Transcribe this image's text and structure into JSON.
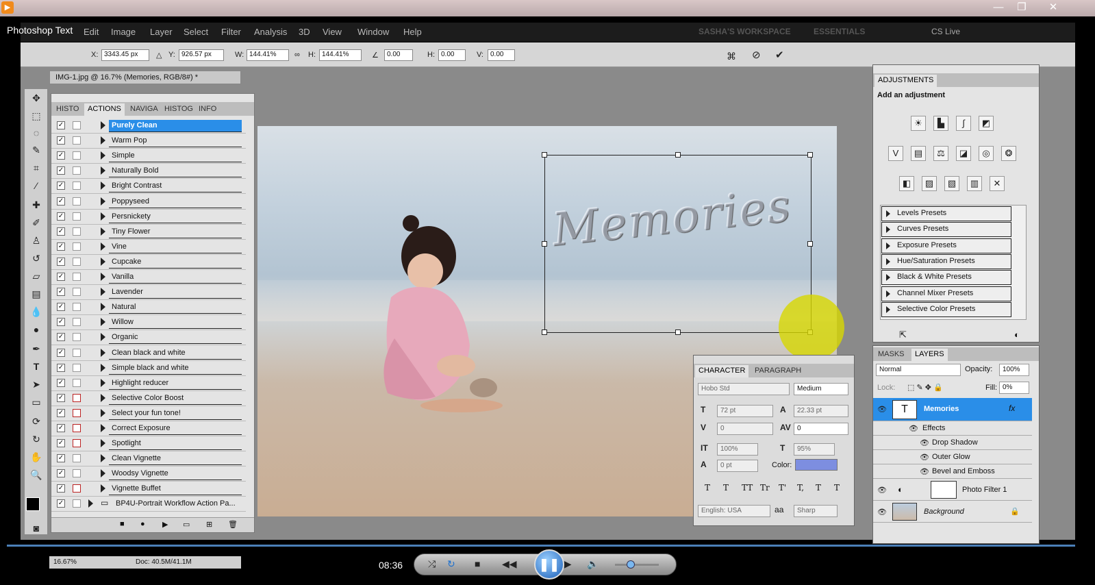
{
  "window": {
    "title": "Photoshop Text",
    "controls": [
      "—",
      "❐",
      "✕"
    ]
  },
  "menu": [
    "Edit",
    "Image",
    "Layer",
    "Select",
    "Filter",
    "Analysis",
    "3D",
    "View",
    "Window",
    "Help"
  ],
  "workspace": [
    "SASHA'S WORKSPACE",
    "ESSENTIALS",
    "CS Live"
  ],
  "options": {
    "x_label": "X:",
    "x_value": "3343.45 px",
    "y_label": "Y:",
    "y_value": "926.57 px",
    "w_label": "W:",
    "w_value": "144.41%",
    "h_label": "H:",
    "h_value": "144.41%",
    "angle_value": "0.00",
    "hskew_label": "H:",
    "hskew_value": "0.00",
    "vskew_label": "V:",
    "vskew_value": "0.00"
  },
  "document": {
    "tab_title": "IMG-1.jpg @ 16.7% (Memories, RGB/8#) *",
    "zoom": "16.67%",
    "doc_size": "Doc: 40.5M/41.1M"
  },
  "actions_panel": {
    "tabs": [
      "HISTO",
      "ACTIONS",
      "NAVIGA",
      "HISTOG",
      "INFO"
    ],
    "items": [
      {
        "name": "Purely Clean",
        "dialog": false,
        "selected": true
      },
      {
        "name": "Warm Pop",
        "dialog": false
      },
      {
        "name": "Simple",
        "dialog": false
      },
      {
        "name": "Naturally Bold",
        "dialog": false
      },
      {
        "name": "Bright Contrast",
        "dialog": false
      },
      {
        "name": "Poppyseed",
        "dialog": false
      },
      {
        "name": "Persnickety",
        "dialog": false
      },
      {
        "name": "Tiny Flower",
        "dialog": false
      },
      {
        "name": "Vine",
        "dialog": false
      },
      {
        "name": "Cupcake",
        "dialog": false
      },
      {
        "name": "Vanilla",
        "dialog": false
      },
      {
        "name": "Lavender",
        "dialog": false
      },
      {
        "name": "Natural",
        "dialog": false
      },
      {
        "name": "Willow",
        "dialog": false
      },
      {
        "name": "Organic",
        "dialog": false
      },
      {
        "name": "Clean black and white",
        "dialog": false
      },
      {
        "name": "Simple black and white",
        "dialog": false
      },
      {
        "name": "Highlight reducer",
        "dialog": false
      },
      {
        "name": "Selective Color Boost",
        "dialog": true
      },
      {
        "name": "Select your fun tone!",
        "dialog": true
      },
      {
        "name": "Correct Exposure",
        "dialog": true
      },
      {
        "name": "Spotlight",
        "dialog": true
      },
      {
        "name": "Clean Vignette",
        "dialog": false
      },
      {
        "name": "Woodsy Vignette",
        "dialog": false
      },
      {
        "name": "Vignette Buffet",
        "dialog": true
      }
    ],
    "set_name": "BP4U-Portrait Workflow Action Pa..."
  },
  "canvas_text": "Memories",
  "character_panel": {
    "tabs": [
      "CHARACTER",
      "PARAGRAPH"
    ],
    "font_family": "Hobo Std",
    "font_style": "Medium",
    "size": "72 pt",
    "leading": "22.33 pt",
    "kerning": "0",
    "tracking": "0",
    "vscale": "100%",
    "hscale": "95%",
    "baseline": "0 pt",
    "color_label": "Color:",
    "color": "#7d8ee0",
    "language": "English: USA",
    "aa_label": "a",
    "antialias": "Sharp",
    "style_buttons": [
      "T",
      "T",
      "TT",
      "Tr",
      "T'",
      "T,",
      "T",
      "T"
    ]
  },
  "adjustments_panel": {
    "tab": "ADJUSTMENTS",
    "heading": "Add an adjustment",
    "presets": [
      "Levels Presets",
      "Curves Presets",
      "Exposure Presets",
      "Hue/Saturation Presets",
      "Black & White Presets",
      "Channel Mixer Presets",
      "Selective Color Presets"
    ]
  },
  "layers_panel": {
    "tabs": [
      "MASKS",
      "LAYERS"
    ],
    "blend_mode": "Normal",
    "opacity_label": "Opacity:",
    "opacity": "100%",
    "lock_label": "Lock:",
    "fill_label": "Fill:",
    "fill": "0%",
    "layers": [
      {
        "name": "Memories",
        "fx": "fx",
        "selected": true
      },
      {
        "name": "Effects"
      },
      {
        "name": "Drop Shadow"
      },
      {
        "name": "Outer Glow"
      },
      {
        "name": "Bevel and Emboss"
      },
      {
        "name": "Photo Filter 1"
      },
      {
        "name": "Background"
      }
    ]
  },
  "player": {
    "time": "08:36"
  }
}
